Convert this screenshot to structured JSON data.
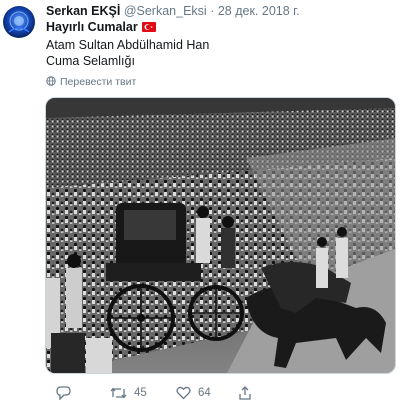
{
  "tweet": {
    "author_name": "Serkan EKŞİ",
    "author_handle": "@Serkan_Eksi",
    "separator": "·",
    "date": "28 дек. 2018 г.",
    "lines": [
      "Hayırlı Cumalar",
      "Atam Sultan Abdülhamid Han",
      "Cuma Selamlığı"
    ],
    "translate_label": "Перевести твит"
  },
  "photo": {
    "description_icon": "historical-photo"
  },
  "actions": {
    "reply_count": "",
    "retweet_count": "45",
    "like_count": "64"
  },
  "colors": {
    "text": "#14171a",
    "muted": "#657786",
    "flag_red": "#e30a17"
  },
  "icons": [
    "reply-icon",
    "retweet-icon",
    "like-icon",
    "share-icon",
    "globe-icon",
    "turkish-flag-icon"
  ]
}
